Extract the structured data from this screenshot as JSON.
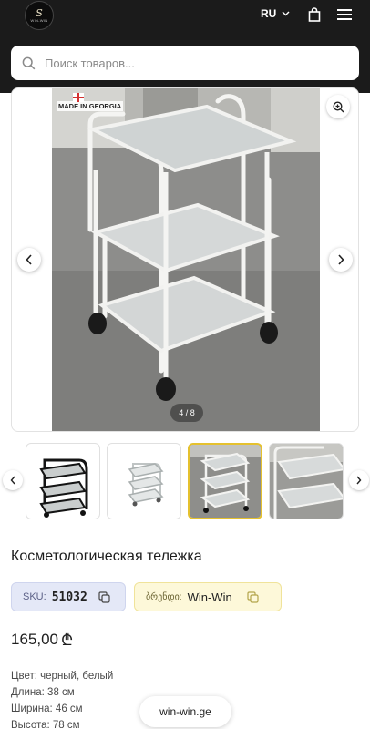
{
  "header": {
    "logo_mark": "S",
    "logo_text": "WIN-WIN",
    "language": "RU",
    "icons": {
      "language_chevron": "chevron-down-icon",
      "cart": "shopping-bag-icon",
      "menu": "hamburger-menu-icon"
    }
  },
  "search": {
    "placeholder": "Поиск товаров...",
    "value": "",
    "icon": "search-icon"
  },
  "gallery": {
    "badge_text": "MADE IN GEORGIA",
    "counter": "4 / 8",
    "current_index": 4,
    "total": 8,
    "icons": {
      "zoom": "zoom-in-icon",
      "prev": "chevron-left-icon",
      "next": "chevron-right-icon"
    }
  },
  "thumbnails": [
    {
      "alt": "black trolley",
      "active": false
    },
    {
      "alt": "trolley render",
      "active": false
    },
    {
      "alt": "white trolley",
      "active": true
    },
    {
      "alt": "trolley close-up",
      "active": false
    }
  ],
  "product": {
    "title": "Косметологическая тележка",
    "sku_label": "SKU:",
    "sku_value": "51032",
    "brand_label": "ბრენდი:",
    "brand_value": "Win-Win",
    "price": "165,00",
    "currency_symbol": "₾",
    "specs": [
      "Цвет: черный, белый",
      "Длина: 38 см",
      "Ширина: 46 см",
      "Высота: 78 см"
    ]
  },
  "site_pill": "win-win.ge",
  "colors": {
    "header_bg": "#1b1b1b",
    "sku_bg": "#e4e8f7",
    "brand_bg": "#fdf8d9",
    "active_thumb": "#e5c12e"
  }
}
